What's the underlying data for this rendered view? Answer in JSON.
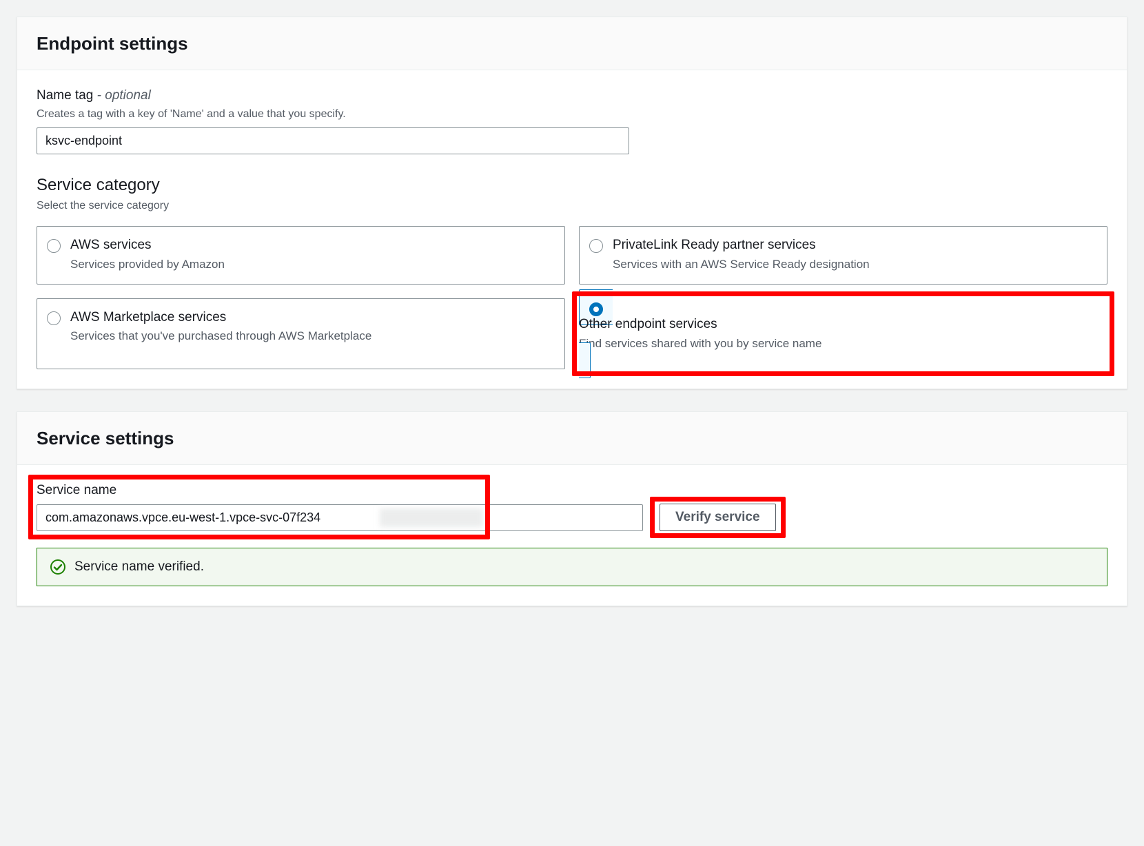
{
  "endpoint_settings": {
    "title": "Endpoint settings",
    "name_tag": {
      "label": "Name tag",
      "optional_suffix": "- optional",
      "help": "Creates a tag with a key of 'Name' and a value that you specify.",
      "value": "ksvc-endpoint"
    },
    "service_category": {
      "title": "Service category",
      "help": "Select the service category",
      "options": [
        {
          "title": "AWS services",
          "desc": "Services provided by Amazon",
          "selected": false
        },
        {
          "title": "PrivateLink Ready partner services",
          "desc": "Services with an AWS Service Ready designation",
          "selected": false
        },
        {
          "title": "AWS Marketplace services",
          "desc": "Services that you've purchased through AWS Marketplace",
          "selected": false
        },
        {
          "title": "Other endpoint services",
          "desc": "Find services shared with you by service name",
          "selected": true
        }
      ]
    }
  },
  "service_settings": {
    "title": "Service settings",
    "service_name": {
      "label": "Service name",
      "value": "com.amazonaws.vpce.eu-west-1.vpce-svc-07f234"
    },
    "verify_button": "Verify service",
    "verified_message": "Service name verified."
  }
}
